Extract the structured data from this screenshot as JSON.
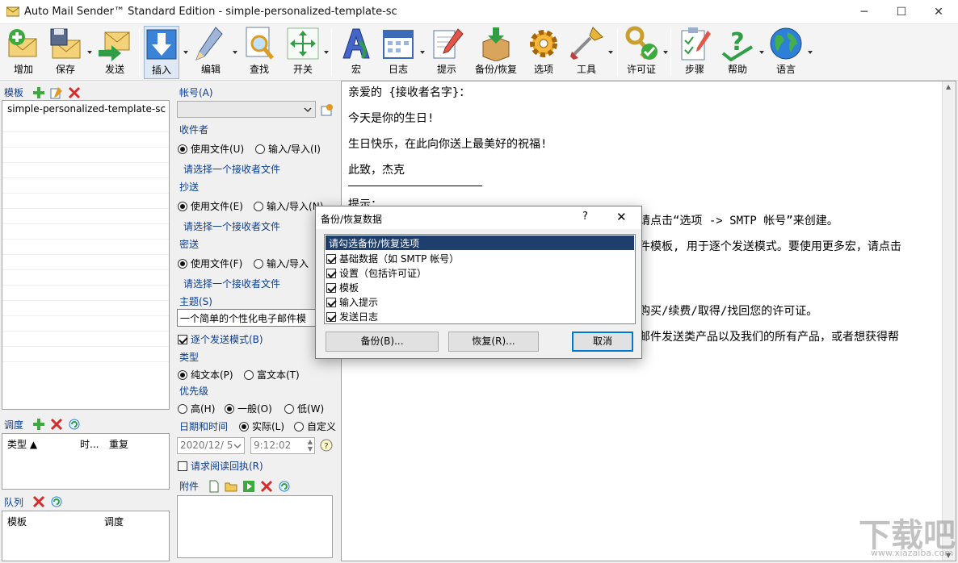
{
  "window": {
    "title": "Auto Mail Sender™ Standard Edition - simple-personalized-template-sc"
  },
  "toolbar": {
    "add": "增加",
    "save": "保存",
    "send": "发送",
    "insert": "插入",
    "edit": "编辑",
    "find": "查找",
    "toggle": "开关",
    "macro": "宏",
    "log": "日志",
    "hint": "提示",
    "backup": "备份/恢复",
    "options": "选项",
    "tools": "工具",
    "license": "许可证",
    "steps": "步骤",
    "help": "帮助",
    "language": "语言"
  },
  "templates": {
    "title": "模板",
    "items": [
      "simple-personalized-template-sc"
    ]
  },
  "schedule": {
    "title": "调度",
    "columns": [
      "类型 ▲",
      "时...",
      "重复"
    ]
  },
  "queue": {
    "title": "队列",
    "columns": [
      "模板",
      "调度"
    ]
  },
  "form": {
    "account_label": "帐号(A)",
    "recipients_label": "收件者",
    "use_file_u": "使用文件(U)",
    "import_i": "输入/导入(I)",
    "select_recipient_file": "请选择一个接收者文件",
    "cc_label": "抄送",
    "use_file_e": "使用文件(E)",
    "import_n": "输入/导入(N)",
    "bcc_label": "密送",
    "use_file_f": "使用文件(F)",
    "import_t": "输入/导入",
    "subject_label": "主题(S)",
    "subject_value": "一个简单的个性化电子邮件模",
    "one_by_one": "逐个发送模式(B)",
    "type_label": "类型",
    "plain_text": "纯文本(P)",
    "rich_text": "富文本(T)",
    "priority_label": "优先级",
    "high": "高(H)",
    "normal": "一般(O)",
    "low": "低(W)",
    "datetime_label": "日期和时间",
    "actual": "实际(L)",
    "custom": "自定义",
    "date_value": "2020/12/ 5",
    "time_value": "9:12:02",
    "read_receipt": "请求阅读回执(R)",
    "attachments_label": "附件"
  },
  "content": {
    "lines": [
      "亲爱的 {接收者名字}：",
      "今天是你的生日!",
      "生日快乐，在此向你送上最美好的祝福!",
      "此致，杰克",
      "提示：",
      "请点击“选项 -> SMTP 帐号”来创建。",
      "件模板, 用于逐个发送模式。要使用更多宏，请点击",
      "购买/续费/取得/找回您的许可证。",
      "邮件发送类产品以及我们的所有产品，或者想获得帮"
    ]
  },
  "dialog": {
    "title": "备份/恢复数据",
    "help": "?",
    "list": [
      {
        "label": "请勾选备份/恢复选项",
        "selected": true,
        "checkbox": false
      },
      {
        "label": "基础数据（如 SMTP 帐号）",
        "checkbox": true
      },
      {
        "label": "设置（包括许可证）",
        "checkbox": true
      },
      {
        "label": "模板",
        "checkbox": true
      },
      {
        "label": "输入提示",
        "checkbox": true
      },
      {
        "label": "发送日志",
        "checkbox": true
      }
    ],
    "backup_btn": "备份(B)...",
    "restore_btn": "恢复(R)...",
    "cancel_btn": "取消"
  },
  "watermark": {
    "text": "下载吧",
    "url": "www.xiazaiba.com"
  },
  "colors": {
    "accent": "#0b3d91",
    "selection": "#1e3f6e"
  }
}
